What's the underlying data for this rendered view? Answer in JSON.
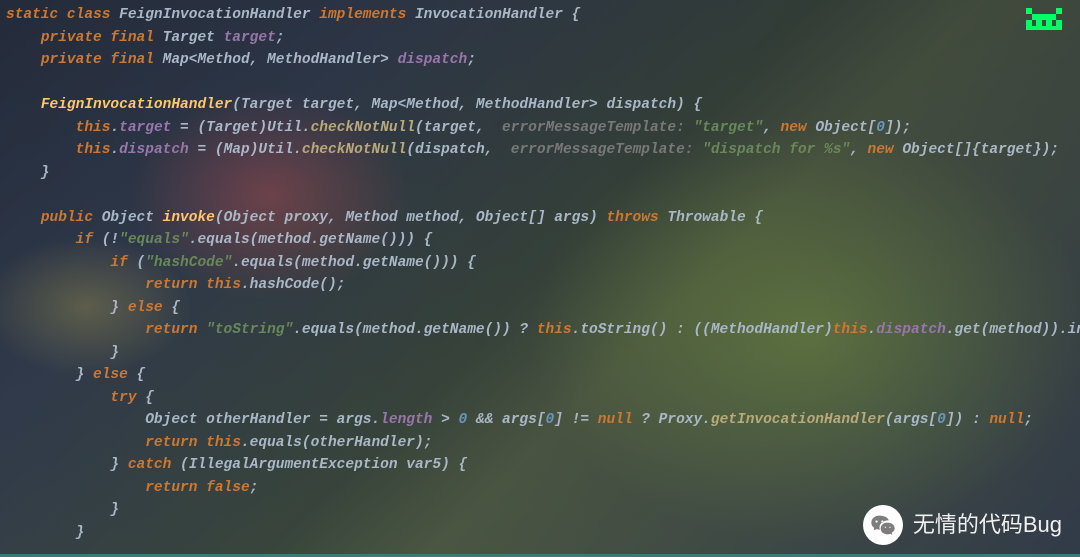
{
  "watermark": {
    "text": "无情的代码Bug"
  },
  "code": {
    "lines": [
      [
        {
          "c": "kw",
          "t": "static class "
        },
        {
          "c": "cls",
          "t": "FeignInvocationHandler "
        },
        {
          "c": "kw",
          "t": "implements "
        },
        {
          "c": "cls",
          "t": "InvocationHandler "
        },
        {
          "c": "punct",
          "t": "{"
        }
      ],
      [
        {
          "c": "punct",
          "t": "    "
        },
        {
          "c": "kw",
          "t": "private final "
        },
        {
          "c": "type",
          "t": "Target "
        },
        {
          "c": "field",
          "t": "target"
        },
        {
          "c": "punct",
          "t": ";"
        }
      ],
      [
        {
          "c": "punct",
          "t": "    "
        },
        {
          "c": "kw",
          "t": "private final "
        },
        {
          "c": "type",
          "t": "Map<Method, MethodHandler> "
        },
        {
          "c": "field",
          "t": "dispatch"
        },
        {
          "c": "punct",
          "t": ";"
        }
      ],
      [
        {
          "c": "punct",
          "t": " "
        }
      ],
      [
        {
          "c": "punct",
          "t": "    "
        },
        {
          "c": "method",
          "t": "FeignInvocationHandler"
        },
        {
          "c": "punct",
          "t": "("
        },
        {
          "c": "type",
          "t": "Target "
        },
        {
          "c": "cls",
          "t": "target, "
        },
        {
          "c": "type",
          "t": "Map"
        },
        {
          "c": "punct",
          "t": "<Method, MethodHandler> dispatch) {"
        }
      ],
      [
        {
          "c": "punct",
          "t": "        "
        },
        {
          "c": "kw",
          "t": "this"
        },
        {
          "c": "punct",
          "t": "."
        },
        {
          "c": "field",
          "t": "target"
        },
        {
          "c": "punct",
          "t": " = ("
        },
        {
          "c": "type",
          "t": "Target"
        },
        {
          "c": "punct",
          "t": ")Util."
        },
        {
          "c": "methodcall",
          "t": "checkNotNull"
        },
        {
          "c": "punct",
          "t": "(target,  "
        },
        {
          "c": "paramlabel",
          "t": "errorMessageTemplate: "
        },
        {
          "c": "str",
          "t": "\"target\""
        },
        {
          "c": "punct",
          "t": ", "
        },
        {
          "c": "kw",
          "t": "new "
        },
        {
          "c": "type",
          "t": "Object["
        },
        {
          "c": "num",
          "t": "0"
        },
        {
          "c": "punct",
          "t": "]);"
        }
      ],
      [
        {
          "c": "punct",
          "t": "        "
        },
        {
          "c": "kw",
          "t": "this"
        },
        {
          "c": "punct",
          "t": "."
        },
        {
          "c": "field",
          "t": "dispatch"
        },
        {
          "c": "punct",
          "t": " = ("
        },
        {
          "c": "type",
          "t": "Map"
        },
        {
          "c": "punct",
          "t": ")Util."
        },
        {
          "c": "methodcall",
          "t": "checkNotNull"
        },
        {
          "c": "punct",
          "t": "(dispatch,  "
        },
        {
          "c": "paramlabel",
          "t": "errorMessageTemplate: "
        },
        {
          "c": "str",
          "t": "\"dispatch for %s\""
        },
        {
          "c": "punct",
          "t": ", "
        },
        {
          "c": "kw",
          "t": "new "
        },
        {
          "c": "type",
          "t": "Object[]"
        },
        {
          "c": "punct",
          "t": "{target});"
        }
      ],
      [
        {
          "c": "punct",
          "t": "    }"
        }
      ],
      [
        {
          "c": "punct",
          "t": " "
        }
      ],
      [
        {
          "c": "punct",
          "t": "    "
        },
        {
          "c": "kw",
          "t": "public "
        },
        {
          "c": "type",
          "t": "Object "
        },
        {
          "c": "method",
          "t": "invoke"
        },
        {
          "c": "punct",
          "t": "(Object proxy, Method method, Object[] args) "
        },
        {
          "c": "kw",
          "t": "throws "
        },
        {
          "c": "type",
          "t": "Throwable "
        },
        {
          "c": "punct",
          "t": "{"
        }
      ],
      [
        {
          "c": "punct",
          "t": "        "
        },
        {
          "c": "kw",
          "t": "if "
        },
        {
          "c": "punct",
          "t": "(!"
        },
        {
          "c": "str",
          "t": "\"equals\""
        },
        {
          "c": "punct",
          "t": ".equals(method.getName())) {"
        }
      ],
      [
        {
          "c": "punct",
          "t": "            "
        },
        {
          "c": "kw",
          "t": "if "
        },
        {
          "c": "punct",
          "t": "("
        },
        {
          "c": "str",
          "t": "\"hashCode\""
        },
        {
          "c": "punct",
          "t": ".equals(method.getName())) {"
        }
      ],
      [
        {
          "c": "punct",
          "t": "                "
        },
        {
          "c": "kw",
          "t": "return this"
        },
        {
          "c": "punct",
          "t": ".hashCode();"
        }
      ],
      [
        {
          "c": "punct",
          "t": "            } "
        },
        {
          "c": "kw",
          "t": "else "
        },
        {
          "c": "punct",
          "t": "{"
        }
      ],
      [
        {
          "c": "punct",
          "t": "                "
        },
        {
          "c": "kw",
          "t": "return "
        },
        {
          "c": "str",
          "t": "\"toString\""
        },
        {
          "c": "punct",
          "t": ".equals(method.getName()) ? "
        },
        {
          "c": "kw",
          "t": "this"
        },
        {
          "c": "punct",
          "t": ".toString() : (("
        },
        {
          "c": "type",
          "t": "MethodHandler"
        },
        {
          "c": "punct",
          "t": ")"
        },
        {
          "c": "kw",
          "t": "this"
        },
        {
          "c": "punct",
          "t": "."
        },
        {
          "c": "field",
          "t": "dispatch"
        },
        {
          "c": "punct",
          "t": ".get(method)).invoke(args"
        }
      ],
      [
        {
          "c": "punct",
          "t": "            }"
        }
      ],
      [
        {
          "c": "punct",
          "t": "        } "
        },
        {
          "c": "kw",
          "t": "else "
        },
        {
          "c": "punct",
          "t": "{"
        }
      ],
      [
        {
          "c": "punct",
          "t": "            "
        },
        {
          "c": "kw",
          "t": "try "
        },
        {
          "c": "punct",
          "t": "{"
        }
      ],
      [
        {
          "c": "punct",
          "t": "                Object otherHandler = args."
        },
        {
          "c": "field",
          "t": "length"
        },
        {
          "c": "punct",
          "t": " > "
        },
        {
          "c": "num",
          "t": "0"
        },
        {
          "c": "punct",
          "t": " && args["
        },
        {
          "c": "num",
          "t": "0"
        },
        {
          "c": "punct",
          "t": "] != "
        },
        {
          "c": "kw",
          "t": "null "
        },
        {
          "c": "punct",
          "t": "? Proxy."
        },
        {
          "c": "methodcall",
          "t": "getInvocationHandler"
        },
        {
          "c": "punct",
          "t": "(args["
        },
        {
          "c": "num",
          "t": "0"
        },
        {
          "c": "punct",
          "t": "]) : "
        },
        {
          "c": "kw",
          "t": "null"
        },
        {
          "c": "punct",
          "t": ";"
        }
      ],
      [
        {
          "c": "punct",
          "t": "                "
        },
        {
          "c": "kw",
          "t": "return this"
        },
        {
          "c": "punct",
          "t": ".equals(otherHandler);"
        }
      ],
      [
        {
          "c": "punct",
          "t": "            } "
        },
        {
          "c": "kw",
          "t": "catch "
        },
        {
          "c": "punct",
          "t": "(IllegalArgumentException var5) {"
        }
      ],
      [
        {
          "c": "punct",
          "t": "                "
        },
        {
          "c": "kw",
          "t": "return false"
        },
        {
          "c": "punct",
          "t": ";"
        }
      ],
      [
        {
          "c": "punct",
          "t": "            }"
        }
      ],
      [
        {
          "c": "punct",
          "t": "        }"
        }
      ]
    ]
  }
}
